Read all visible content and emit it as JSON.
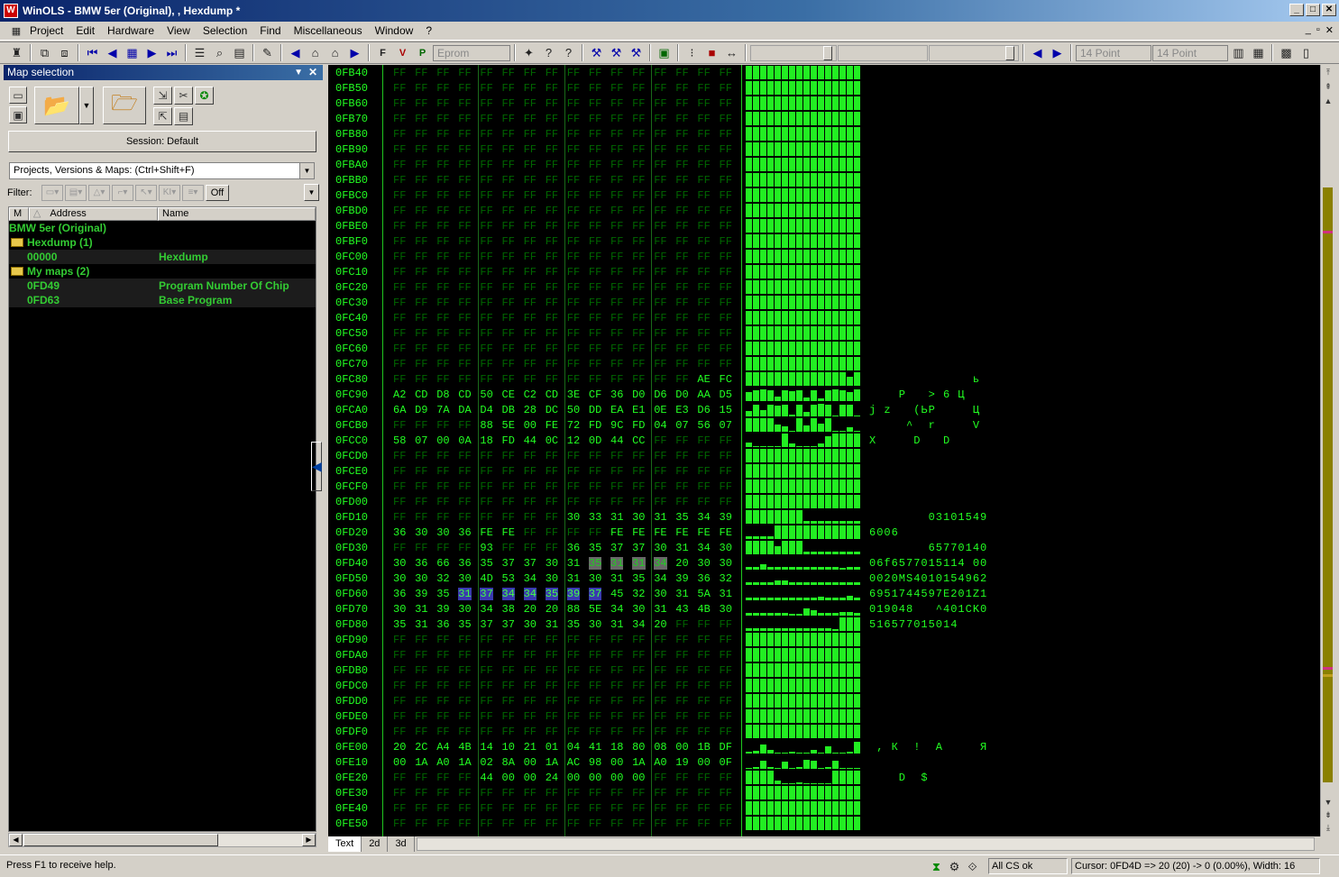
{
  "window": {
    "title": "WinOLS - BMW 5er (Original), , Hexdump *",
    "controls": [
      "_",
      "□",
      "✕"
    ]
  },
  "menu": {
    "items": [
      "Project",
      "Edit",
      "Hardware",
      "View",
      "Selection",
      "Find",
      "Miscellaneous",
      "Window",
      "?"
    ],
    "mdi_controls": [
      "_",
      "▫",
      "✕"
    ]
  },
  "toolbar": {
    "eprom_label": "Eprom",
    "font_size_1": "14 Point",
    "font_size_2": "14 Point"
  },
  "left_panel": {
    "title": "Map selection",
    "session_label": "Session: Default",
    "projects_combo": "Projects, Versions & Maps:  (Ctrl+Shift+F)",
    "filter_label": "Filter:",
    "filter_off": "Off",
    "columns": {
      "m": "M",
      "address": "Address",
      "name": "Name"
    },
    "tree": [
      {
        "text": "BMW 5er (Original)",
        "addr": "",
        "name": "",
        "level": 0,
        "folder": false
      },
      {
        "text": "Hexdump (1)",
        "addr": "",
        "name": "",
        "level": 1,
        "folder": true
      },
      {
        "text": "",
        "addr": "00000",
        "name": "Hexdump",
        "level": 2,
        "folder": false
      },
      {
        "text": "My maps (2)",
        "addr": "",
        "name": "",
        "level": 1,
        "folder": true
      },
      {
        "text": "",
        "addr": "0FD49",
        "name": "Program Number Of Chip",
        "level": 2,
        "folder": false
      },
      {
        "text": "",
        "addr": "0FD63",
        "name": "Base Program",
        "level": 2,
        "folder": false
      }
    ]
  },
  "hex": {
    "rows": [
      {
        "a": "0FB40",
        "b": "FF FF FF FF FF FF FF FF FF FF FF FF FF FF FF FF",
        "t": ""
      },
      {
        "a": "0FB50",
        "b": "FF FF FF FF FF FF FF FF FF FF FF FF FF FF FF FF",
        "t": ""
      },
      {
        "a": "0FB60",
        "b": "FF FF FF FF FF FF FF FF FF FF FF FF FF FF FF FF",
        "t": ""
      },
      {
        "a": "0FB70",
        "b": "FF FF FF FF FF FF FF FF FF FF FF FF FF FF FF FF",
        "t": ""
      },
      {
        "a": "0FB80",
        "b": "FF FF FF FF FF FF FF FF FF FF FF FF FF FF FF FF",
        "t": ""
      },
      {
        "a": "0FB90",
        "b": "FF FF FF FF FF FF FF FF FF FF FF FF FF FF FF FF",
        "t": ""
      },
      {
        "a": "0FBA0",
        "b": "FF FF FF FF FF FF FF FF FF FF FF FF FF FF FF FF",
        "t": ""
      },
      {
        "a": "0FBB0",
        "b": "FF FF FF FF FF FF FF FF FF FF FF FF FF FF FF FF",
        "t": ""
      },
      {
        "a": "0FBC0",
        "b": "FF FF FF FF FF FF FF FF FF FF FF FF FF FF FF FF",
        "t": ""
      },
      {
        "a": "0FBD0",
        "b": "FF FF FF FF FF FF FF FF FF FF FF FF FF FF FF FF",
        "t": ""
      },
      {
        "a": "0FBE0",
        "b": "FF FF FF FF FF FF FF FF FF FF FF FF FF FF FF FF",
        "t": ""
      },
      {
        "a": "0FBF0",
        "b": "FF FF FF FF FF FF FF FF FF FF FF FF FF FF FF FF",
        "t": ""
      },
      {
        "a": "0FC00",
        "b": "FF FF FF FF FF FF FF FF FF FF FF FF FF FF FF FF",
        "t": ""
      },
      {
        "a": "0FC10",
        "b": "FF FF FF FF FF FF FF FF FF FF FF FF FF FF FF FF",
        "t": ""
      },
      {
        "a": "0FC20",
        "b": "FF FF FF FF FF FF FF FF FF FF FF FF FF FF FF FF",
        "t": ""
      },
      {
        "a": "0FC30",
        "b": "FF FF FF FF FF FF FF FF FF FF FF FF FF FF FF FF",
        "t": ""
      },
      {
        "a": "0FC40",
        "b": "FF FF FF FF FF FF FF FF FF FF FF FF FF FF FF FF",
        "t": ""
      },
      {
        "a": "0FC50",
        "b": "FF FF FF FF FF FF FF FF FF FF FF FF FF FF FF FF",
        "t": ""
      },
      {
        "a": "0FC60",
        "b": "FF FF FF FF FF FF FF FF FF FF FF FF FF FF FF FF",
        "t": ""
      },
      {
        "a": "0FC70",
        "b": "FF FF FF FF FF FF FF FF FF FF FF FF FF FF FF FF",
        "t": ""
      },
      {
        "a": "0FC80",
        "b": "FF FF FF FF FF FF FF FF FF FF FF FF FF FF AE FC",
        "t": "              ь"
      },
      {
        "a": "0FC90",
        "b": "A2 CD D8 CD 50 CE C2 CD 3E CF 36 D0 D6 D0 AA D5",
        "t": "    Р   > 6 Ц"
      },
      {
        "a": "0FCA0",
        "b": "6A D9 7A DA D4 DB 28 DC 50 DD EA E1 0E E3 D6 15",
        "t": "j z   (ЬР     Ц"
      },
      {
        "a": "0FCB0",
        "b": "FF FF FF FF 88 5E 00 FE 72 FD 9C FD 04 07 56 07",
        "t": "     ^  r     V"
      },
      {
        "a": "0FCC0",
        "b": "58 07 00 0A 18 FD 44 0C 12 0D 44 CC FF FF FF FF",
        "t": "X     D   D"
      },
      {
        "a": "0FCD0",
        "b": "FF FF FF FF FF FF FF FF FF FF FF FF FF FF FF FF",
        "t": ""
      },
      {
        "a": "0FCE0",
        "b": "FF FF FF FF FF FF FF FF FF FF FF FF FF FF FF FF",
        "t": ""
      },
      {
        "a": "0FCF0",
        "b": "FF FF FF FF FF FF FF FF FF FF FF FF FF FF FF FF",
        "t": ""
      },
      {
        "a": "0FD00",
        "b": "FF FF FF FF FF FF FF FF FF FF FF FF FF FF FF FF",
        "t": ""
      },
      {
        "a": "0FD10",
        "b": "FF FF FF FF FF FF FF FF 30 33 31 30 31 35 34 39",
        "t": "        03101549"
      },
      {
        "a": "0FD20",
        "b": "36 30 30 36 FE FE FF FF FF FF FE FE FE FE FE FE",
        "t": "6006"
      },
      {
        "a": "0FD30",
        "b": "FF FF FF FF 93 FF FF FF 36 35 37 37 30 31 34 30",
        "t": "        65770140"
      },
      {
        "a": "0FD40",
        "b": "30 36 66 36 35 37 37 30 31 35 31 31 34 20 30 30",
        "t": "06f6577015114 00"
      },
      {
        "a": "0FD50",
        "b": "30 30 32 30 4D 53 34 30 31 30 31 35 34 39 36 32",
        "t": "0020MS4010154962"
      },
      {
        "a": "0FD60",
        "b": "36 39 35 31 37 34 34 35 39 37 45 32 30 31 5A 31",
        "t": "6951744597E201Z1"
      },
      {
        "a": "0FD70",
        "b": "30 31 39 30 34 38 20 20 88 5E 34 30 31 43 4B 30",
        "t": "019048   ^401CK0"
      },
      {
        "a": "0FD80",
        "b": "35 31 36 35 37 37 30 31 35 30 31 34 20 FF FF FF",
        "t": "516577015014"
      },
      {
        "a": "0FD90",
        "b": "FF FF FF FF FF FF FF FF FF FF FF FF FF FF FF FF",
        "t": ""
      },
      {
        "a": "0FDA0",
        "b": "FF FF FF FF FF FF FF FF FF FF FF FF FF FF FF FF",
        "t": ""
      },
      {
        "a": "0FDB0",
        "b": "FF FF FF FF FF FF FF FF FF FF FF FF FF FF FF FF",
        "t": ""
      },
      {
        "a": "0FDC0",
        "b": "FF FF FF FF FF FF FF FF FF FF FF FF FF FF FF FF",
        "t": ""
      },
      {
        "a": "0FDD0",
        "b": "FF FF FF FF FF FF FF FF FF FF FF FF FF FF FF FF",
        "t": ""
      },
      {
        "a": "0FDE0",
        "b": "FF FF FF FF FF FF FF FF FF FF FF FF FF FF FF FF",
        "t": ""
      },
      {
        "a": "0FDF0",
        "b": "FF FF FF FF FF FF FF FF FF FF FF FF FF FF FF FF",
        "t": ""
      },
      {
        "a": "0FE00",
        "b": "20 2C A4 4B 14 10 21 01 04 41 18 80 08 00 1B DF",
        "t": " , К  !  А     Я"
      },
      {
        "a": "0FE10",
        "b": "00 1A A0 1A 02 8A 00 1A AC 98 00 1A A0 19 00 0F",
        "t": ""
      },
      {
        "a": "0FE20",
        "b": "FF FF FF FF 44 00 00 24 00 00 00 00 FF FF FF FF",
        "t": "    D  $"
      },
      {
        "a": "0FE30",
        "b": "FF FF FF FF FF FF FF FF FF FF FF FF FF FF FF FF",
        "t": ""
      },
      {
        "a": "0FE40",
        "b": "FF FF FF FF FF FF FF FF FF FF FF FF FF FF FF FF",
        "t": ""
      },
      {
        "a": "0FE50",
        "b": "FF FF FF FF FF FF FF FF FF FF FF FF FF FF FF FF",
        "t": ""
      }
    ]
  },
  "tabs": [
    "Text",
    "2d",
    "3d"
  ],
  "status": {
    "help": "Press F1 to receive help.",
    "checksum": "All CS ok",
    "cursor": "Cursor: 0FD4D => 20 (20) ->  0 (0.00%), Width: 16"
  }
}
